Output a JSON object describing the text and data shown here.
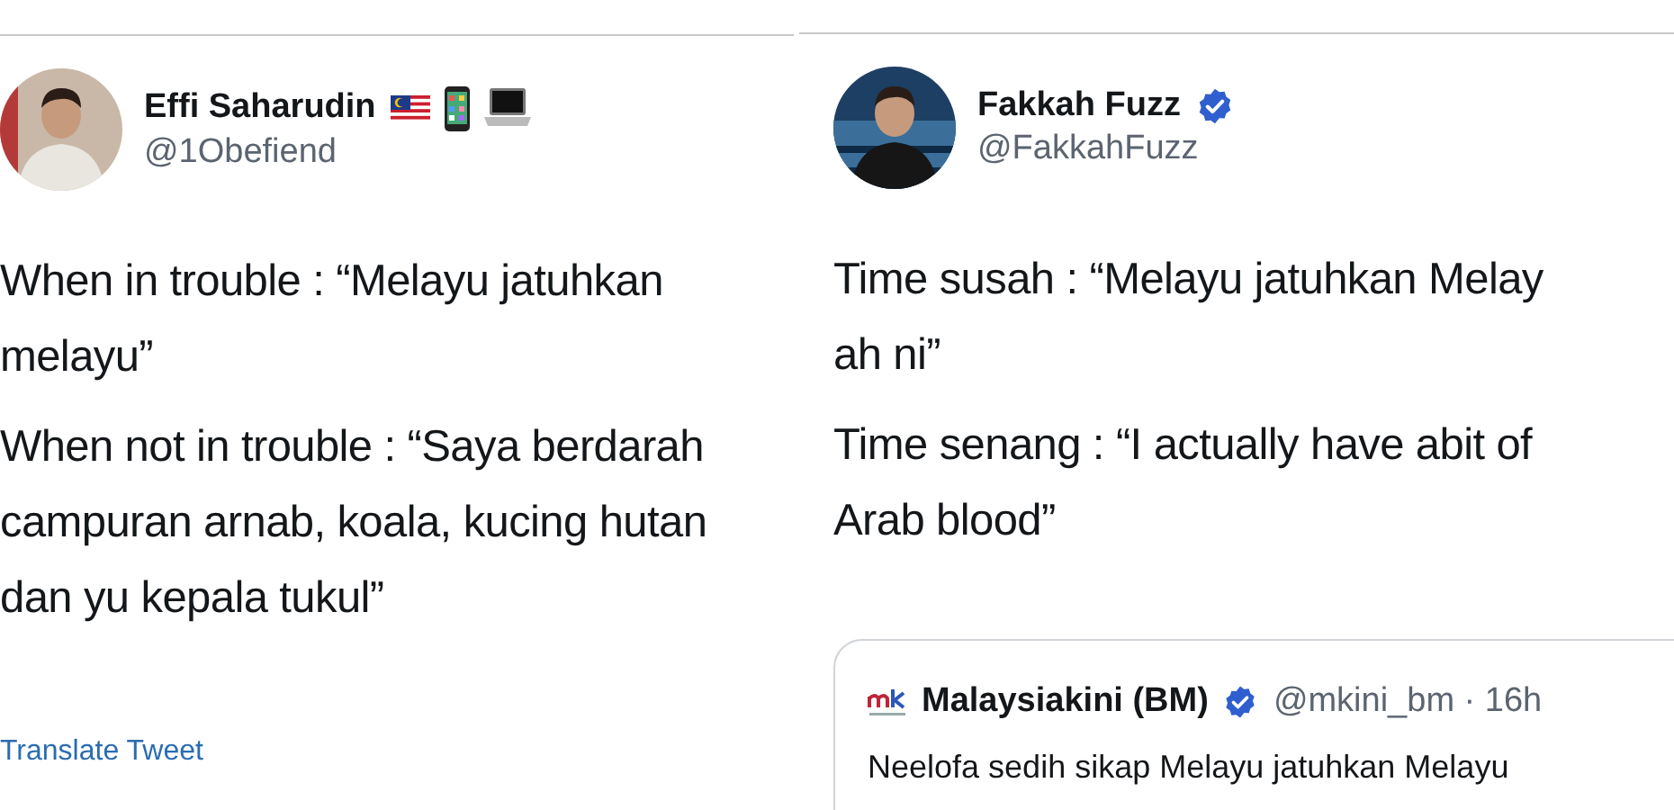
{
  "tweets": [
    {
      "name": "Effi Saharudin",
      "handle": "@1Obefiend",
      "verified": false,
      "name_emoji": [
        {
          "kind": "flag"
        },
        {
          "kind": "phone"
        },
        {
          "kind": "laptop"
        }
      ],
      "paragraphs": [
        "When in trouble : “Melayu jatuhkan\nmelayu”",
        "When not in trouble : “Saya berdarah\ncampuran arnab, koala, kucing hutan\ndan yu kepala tukul”"
      ],
      "translate_link": "Translate Tweet"
    },
    {
      "name": "Fakkah Fuzz",
      "handle": "@FakkahFuzz",
      "verified": true,
      "paragraphs": [
        "Time susah : “Melayu jatuhkan Melay\nah ni”",
        "Time senang : “I actually have abit of\nArab blood”"
      ],
      "quoted_tweet": {
        "name": "Malaysiakini (BM)",
        "verified": true,
        "handle_time": "@mkini_bm · 16h",
        "text": "Neelofa sedih sikap Melayu jatuhkan Melayu"
      }
    }
  ]
}
